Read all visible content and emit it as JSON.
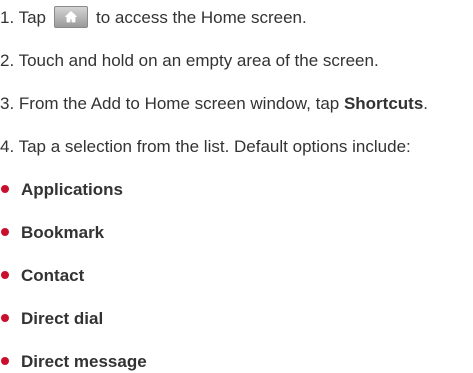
{
  "steps": {
    "step1_before": "1. Tap",
    "step1_after": "to access the Home screen.",
    "step2": "2. Touch and hold on an empty area of the screen.",
    "step3_before": "3. From the Add to Home screen window, tap ",
    "step3_bold": "Shortcuts",
    "step3_after": ".",
    "step4": "4. Tap a selection from the list. Default options include:"
  },
  "options": [
    "Applications",
    "Bookmark",
    "Contact",
    "Direct dial",
    "Direct message"
  ],
  "icons": {
    "home_button": "home-icon",
    "bullet": "bullet-icon"
  },
  "colors": {
    "text": "#333333",
    "bullet": "#c8102e"
  }
}
